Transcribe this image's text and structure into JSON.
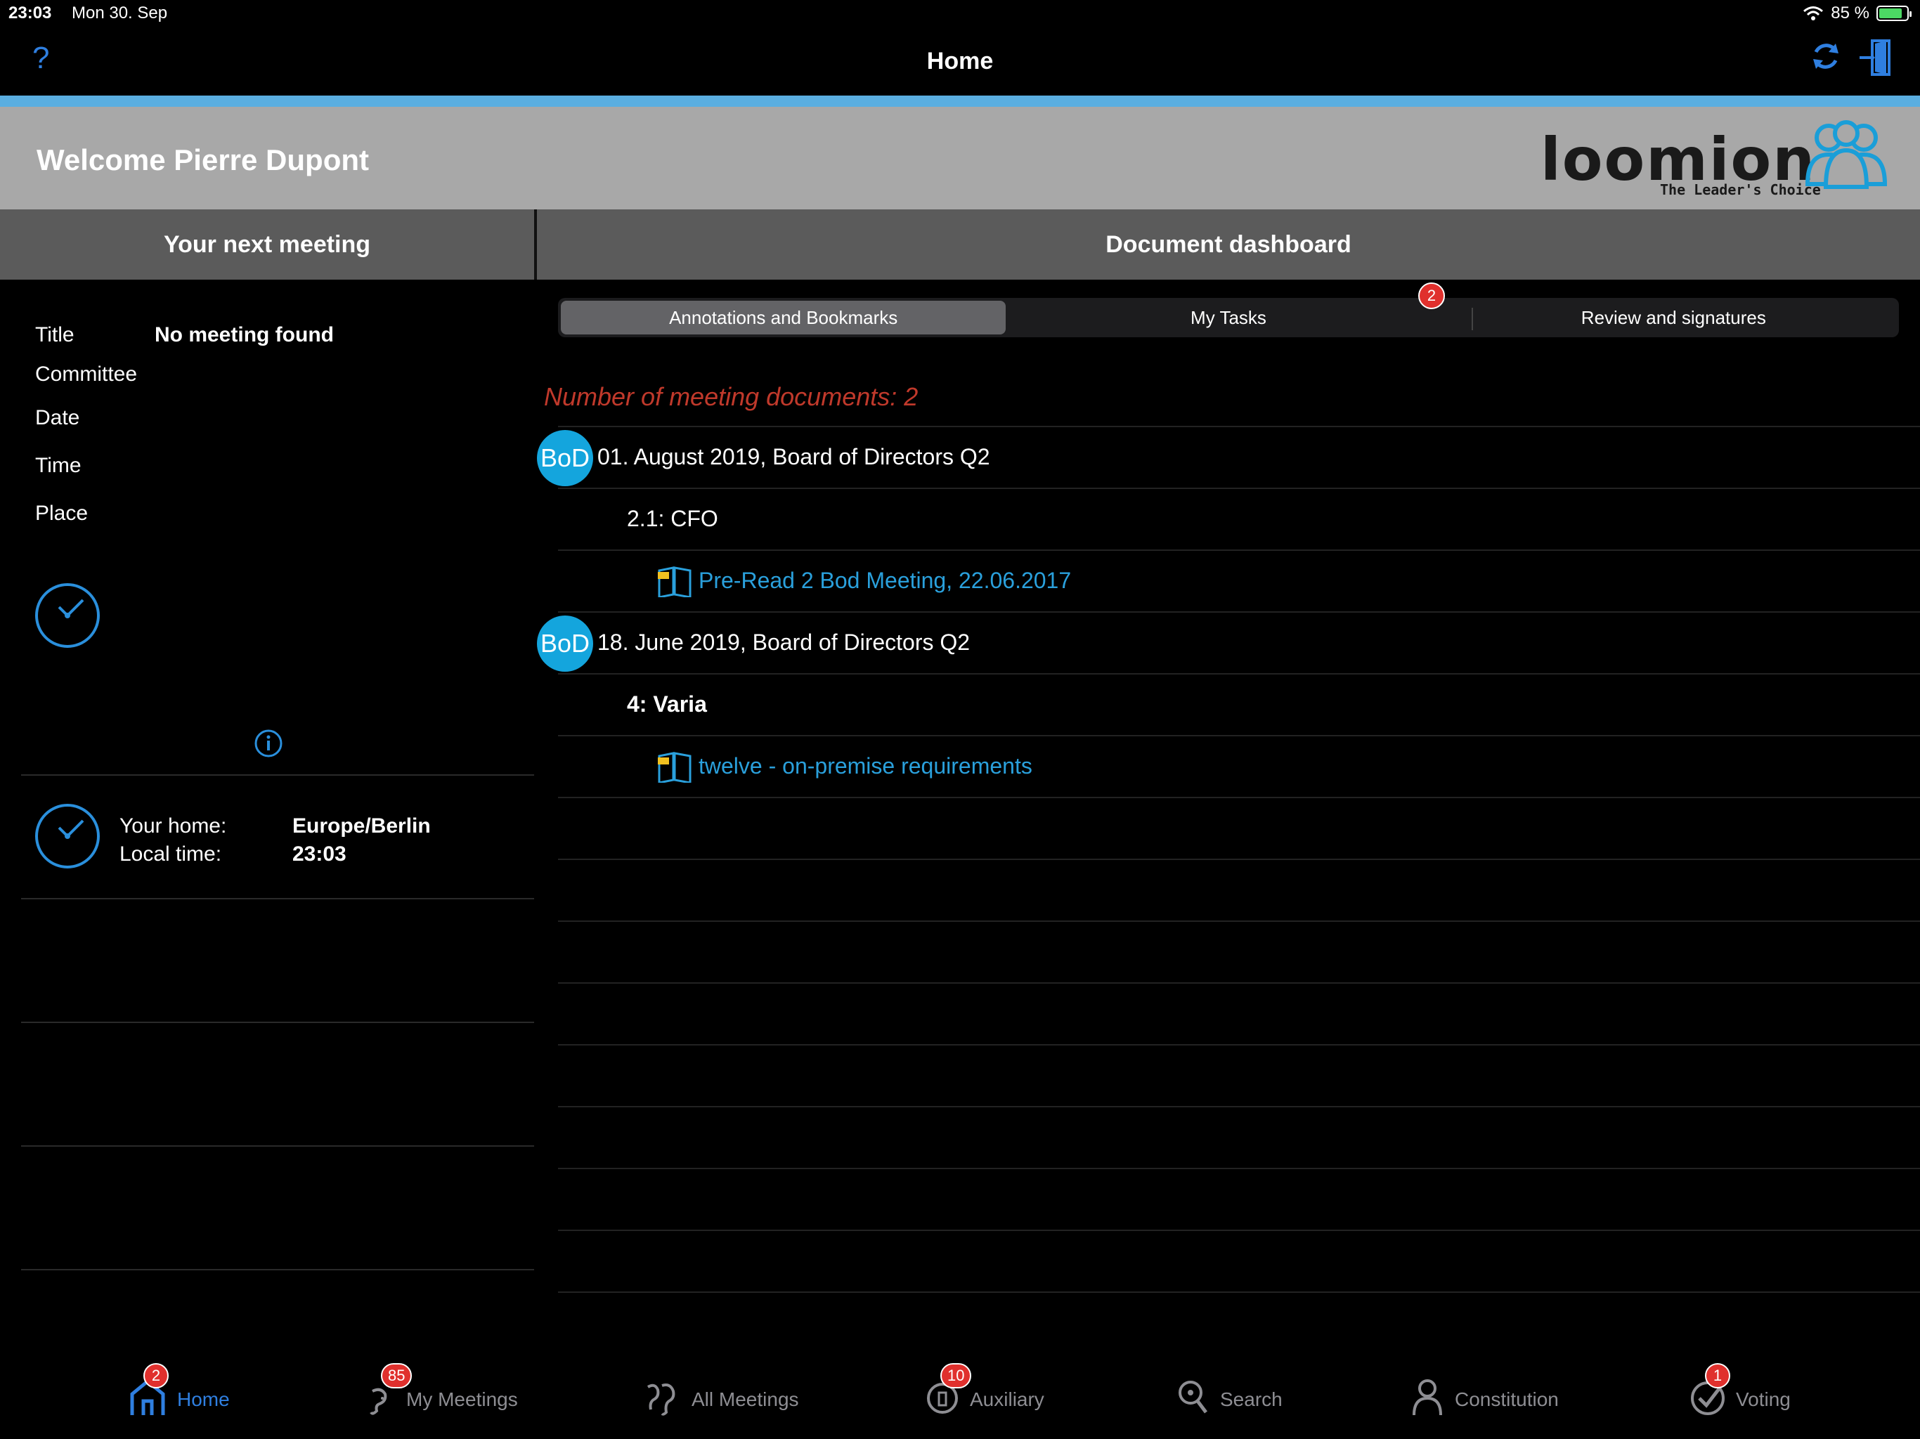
{
  "status": {
    "time": "23:03",
    "date": "Mon 30. Sep",
    "battery": "85 %",
    "battery_level": 0.85
  },
  "nav": {
    "help": "?",
    "title": "Home"
  },
  "welcome": {
    "text": "Welcome Pierre Dupont"
  },
  "logo": {
    "word": "loomion",
    "tagline": "The Leader's Choice"
  },
  "next_meeting": {
    "header": "Your next meeting",
    "fields": [
      {
        "label": "Title",
        "value": "No meeting found"
      },
      {
        "label": "Committee",
        "value": ""
      },
      {
        "label": "Date",
        "value": ""
      },
      {
        "label": "Time",
        "value": ""
      },
      {
        "label": "Place",
        "value": ""
      }
    ],
    "home_label": "Your home:",
    "home_value": "Europe/Berlin",
    "local_label": "Local time:",
    "local_value": "23:03"
  },
  "dashboard": {
    "header": "Document dashboard",
    "tabs": [
      {
        "label": "Annotations and Bookmarks"
      },
      {
        "label": "My Tasks"
      },
      {
        "label": "Review and signatures"
      }
    ],
    "tasks_badge": "2",
    "doc_count": "Number of meeting documents: 2",
    "meetings": [
      {
        "badge": "BoD",
        "title": "01. August 2019, Board of Directors Q2",
        "item": "2.1: CFO",
        "document": "Pre-Read  2 Bod Meeting, 22.06.2017"
      },
      {
        "badge": "BoD",
        "title": "18. June 2019, Board of Directors Q2",
        "item": "4: Varia",
        "document": "twelve - on-premise requirements"
      }
    ]
  },
  "tabbar": {
    "items": [
      {
        "label": "Home",
        "badge": "2",
        "icon": "home-icon"
      },
      {
        "label": "My Meetings",
        "badge": "85",
        "icon": "my-meetings-icon"
      },
      {
        "label": "All Meetings",
        "badge": "",
        "icon": "all-meetings-icon"
      },
      {
        "label": "Auxiliary",
        "badge": "10",
        "icon": "auxiliary-icon"
      },
      {
        "label": "Search",
        "badge": "",
        "icon": "search-icon"
      },
      {
        "label": "Constitution",
        "badge": "",
        "icon": "constitution-icon"
      },
      {
        "label": "Voting",
        "badge": "1",
        "icon": "voting-icon"
      }
    ]
  },
  "colors": {
    "accent": "#5aaee0",
    "link": "#2aa0dc",
    "badge": "#e0302d",
    "bod": "#14a5dd",
    "count": "#c0392b"
  }
}
